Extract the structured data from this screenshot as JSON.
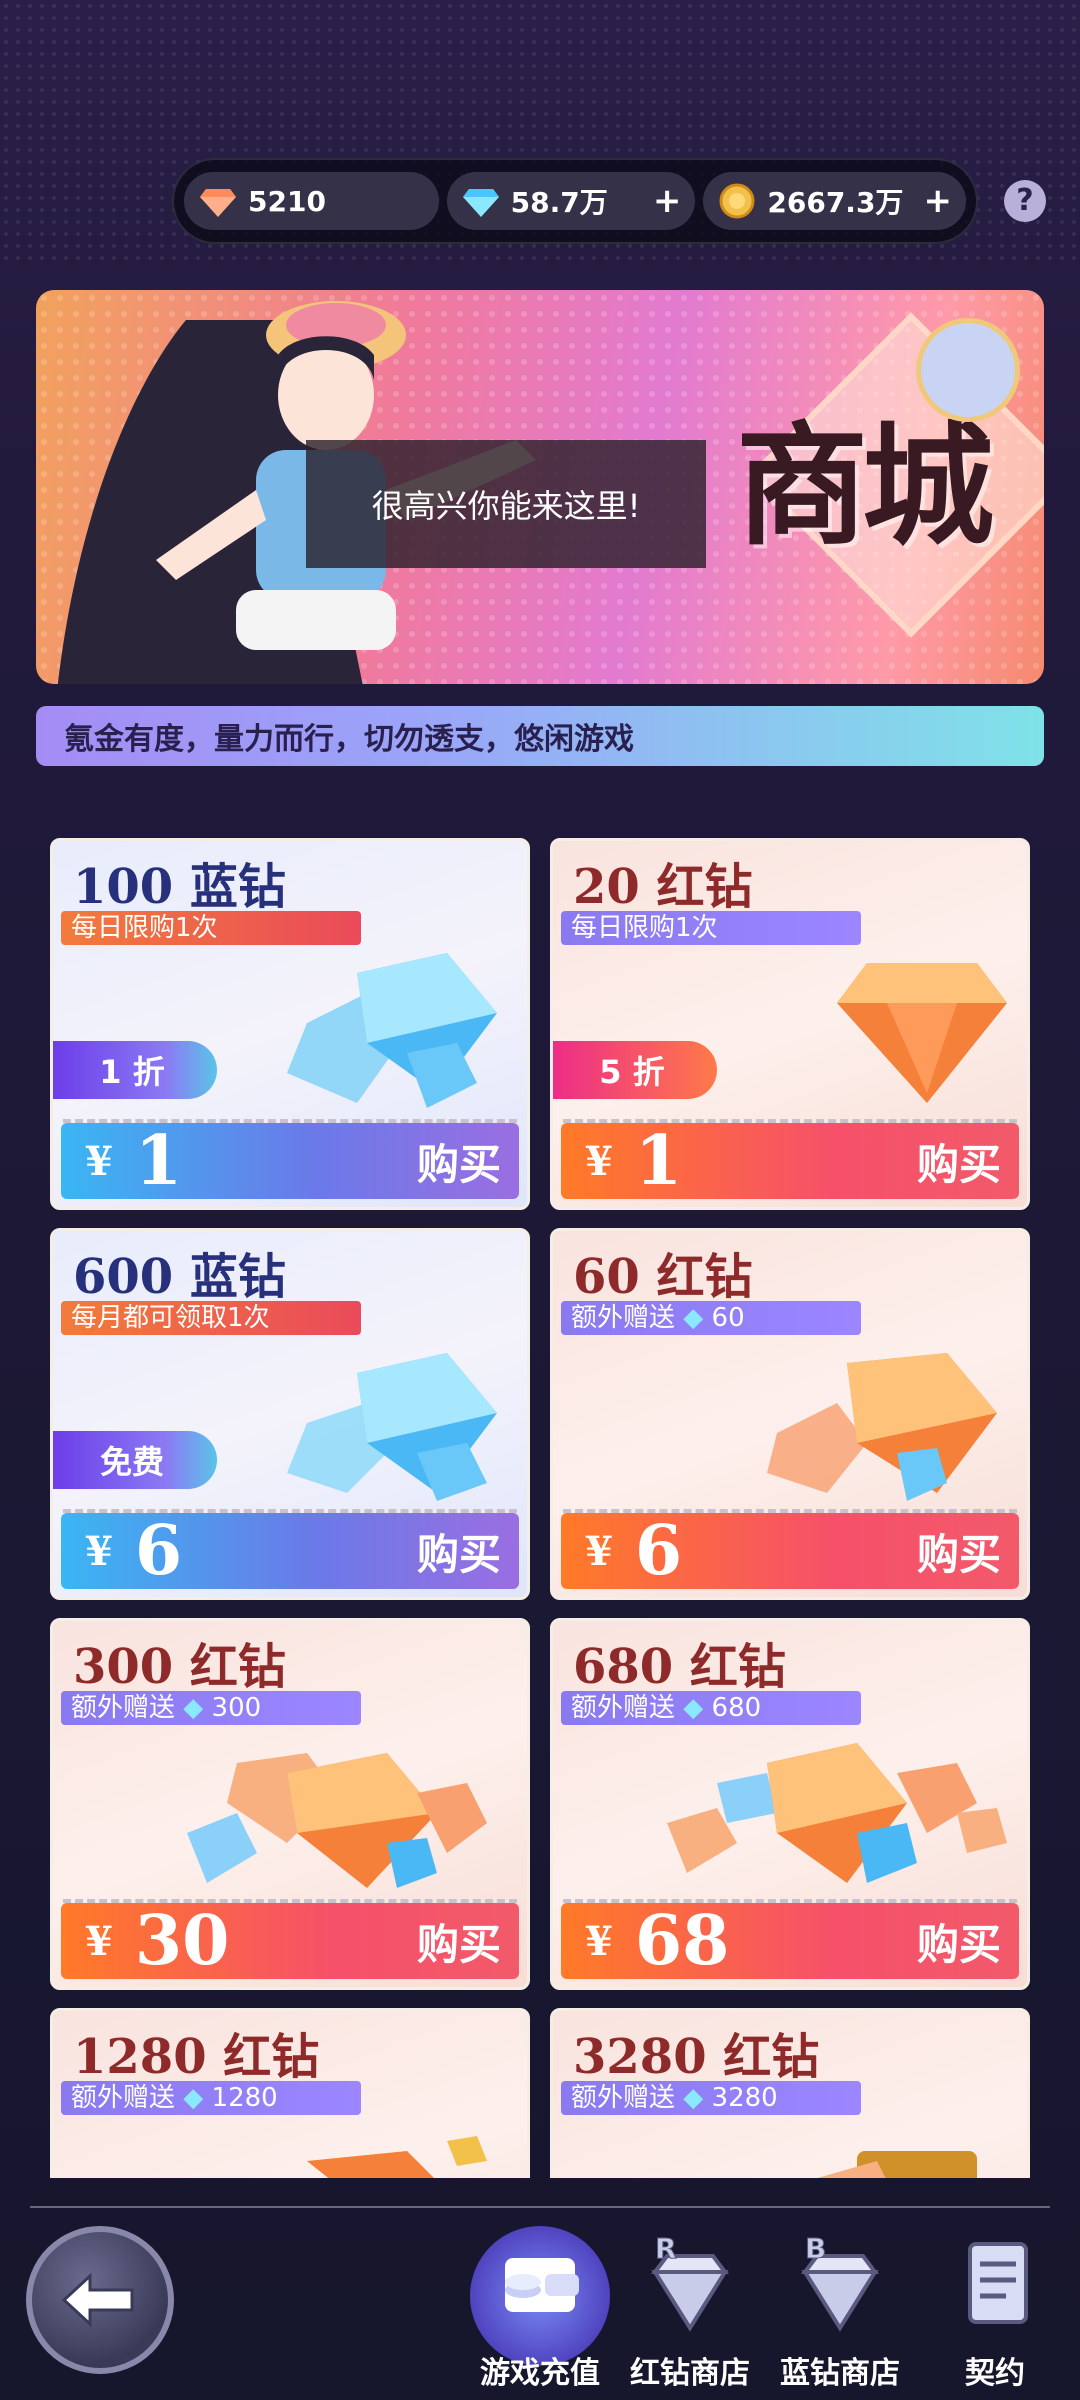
{
  "currency": {
    "red_gem": "5210",
    "blue_gem": "58.7万",
    "gold_coin": "2667.3万",
    "help": "?"
  },
  "banner": {
    "speech": "很高兴你能来这里!",
    "title": "商城"
  },
  "warning": "氪金有度，量力而行，切勿透支，悠闲游戏",
  "products": [
    {
      "title": "100 蓝钻",
      "tag": "每日限购1次",
      "discount": "1 折",
      "yen": "¥",
      "price": "1",
      "buy": "购买"
    },
    {
      "title": "20 红钻",
      "tag": "每日限购1次",
      "discount": "5 折",
      "yen": "¥",
      "price": "1",
      "buy": "购买"
    },
    {
      "title": "600 蓝钻",
      "tag": "每月都可领取1次",
      "discount": "免费",
      "yen": "¥",
      "price": "6",
      "buy": "购买"
    },
    {
      "title": "60 红钻",
      "tag_prefix": "额外赠送",
      "tag_value": "60",
      "yen": "¥",
      "price": "6",
      "buy": "购买"
    },
    {
      "title": "300 红钻",
      "tag_prefix": "额外赠送",
      "tag_value": "300",
      "yen": "¥",
      "price": "30",
      "buy": "购买"
    },
    {
      "title": "680 红钻",
      "tag_prefix": "额外赠送",
      "tag_value": "680",
      "yen": "¥",
      "price": "68",
      "buy": "购买"
    },
    {
      "title": "1280 红钻",
      "tag_prefix": "额外赠送",
      "tag_value": "1280"
    },
    {
      "title": "3280 红钻",
      "tag_prefix": "额外赠送",
      "tag_value": "3280"
    }
  ],
  "nav": {
    "recharge": "游戏充值",
    "red_shop": "红钻商店",
    "blue_shop": "蓝钻商店",
    "contract": "契约",
    "red_badge": "R",
    "blue_badge": "B"
  },
  "colors": {
    "accent_blue": "#3ab6f2",
    "accent_red": "#f6506a",
    "bg": "#1b1834"
  }
}
